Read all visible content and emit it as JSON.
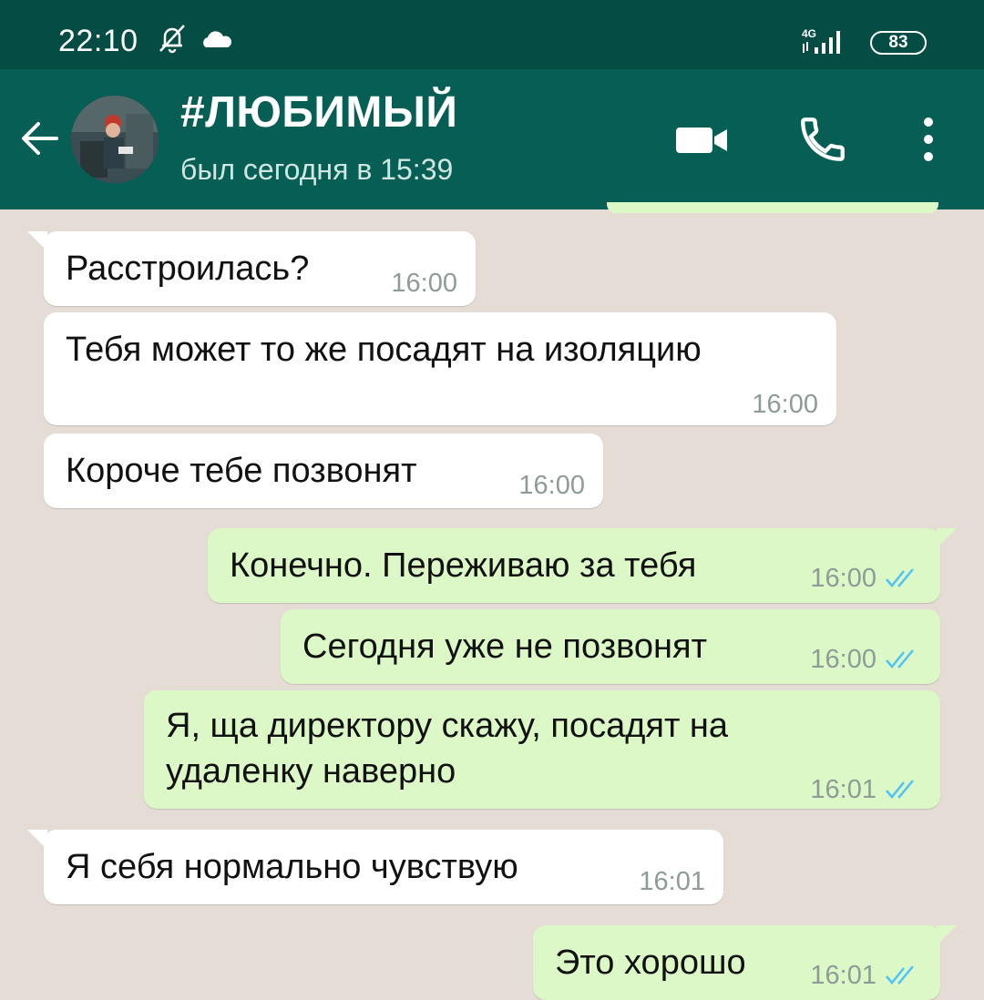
{
  "status_bar": {
    "time": "22:10",
    "network": "4G",
    "battery": "83"
  },
  "header": {
    "contact_name": "#ЛЮБИМЫЙ",
    "last_seen": "был сегодня в 15:39"
  },
  "icons": {
    "back": "arrow-left-icon",
    "video": "video-camera-icon",
    "call": "phone-icon",
    "menu": "more-vert-icon",
    "read_receipt": "double-check-icon"
  },
  "colors": {
    "status_bar": "#054d44",
    "header": "#075e54",
    "chat_bg": "#e5ddd5",
    "incoming": "#ffffff",
    "outgoing": "#dcf8c6",
    "read_ticks": "#4fc3f7"
  },
  "messages": [
    {
      "direction": "in",
      "text": "Расстроилась?",
      "time": "16:00"
    },
    {
      "direction": "in",
      "text": "Тебя может то же посадят на изоляцию",
      "time": "16:00"
    },
    {
      "direction": "in",
      "text": "Короче тебе позвонят",
      "time": "16:00"
    },
    {
      "direction": "out",
      "text": "Конечно. Переживаю за тебя",
      "time": "16:00",
      "read": true
    },
    {
      "direction": "out",
      "text": "Сегодня уже не позвонят",
      "time": "16:00",
      "read": true
    },
    {
      "direction": "out",
      "text": "Я, ща директору скажу, посадят на удаленку наверно",
      "time": "16:01",
      "read": true
    },
    {
      "direction": "in",
      "text": "Я себя нормально чувствую",
      "time": "16:01"
    },
    {
      "direction": "out",
      "text": "Это хорошо",
      "time": "16:01",
      "read": true
    }
  ]
}
